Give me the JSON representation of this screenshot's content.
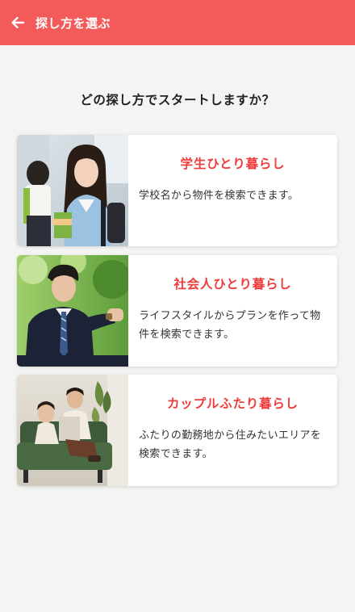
{
  "header": {
    "title": "探し方を選ぶ",
    "background": "#f35b5b"
  },
  "question": "どの探し方でスタートしますか？",
  "cards": [
    {
      "title": "学生ひとり暮らし",
      "description": "学校名から物件を検索できます。",
      "photo": "student-photo"
    },
    {
      "title": "社会人ひとり暮らし",
      "description": "ライフスタイルからプランを作って物件を検索できます。",
      "photo": "businessman-photo"
    },
    {
      "title": "カップルふたり暮らし",
      "description": "ふたりの勤務地から住みたいエリアを検索できます。",
      "photo": "couple-photo"
    }
  ],
  "colors": {
    "accent": "#ee3b3b",
    "page_background": "#f4f4f2",
    "card_background": "#ffffff"
  }
}
